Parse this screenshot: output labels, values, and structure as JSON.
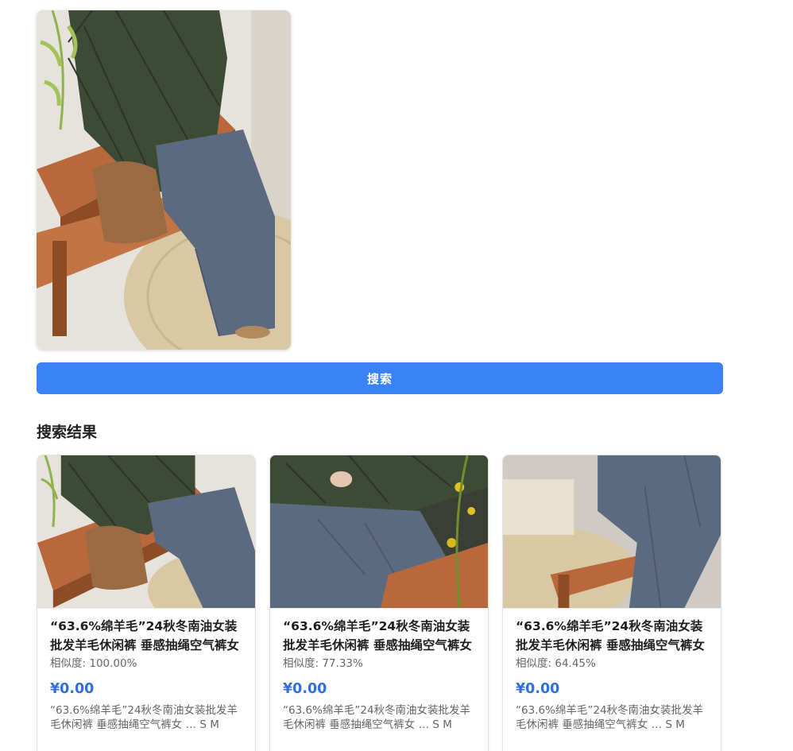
{
  "query": {
    "image_alt": "上传的查询图片：绿色菱格棉服搭配灰蓝色羊毛阔腿裤，坐在木质长椅上"
  },
  "search_button": {
    "label": "搜索"
  },
  "results": {
    "title": "搜索结果",
    "items": [
      {
        "title": "“63.6%绵羊毛”24秋冬南油女装批发羊毛休闲裤 垂感抽绳空气裤女",
        "similarity_label": "相似度:",
        "similarity": "100.00%",
        "price": "¥0.00",
        "description": "“63.6%绵羊毛”24秋冬南油女装批发羊毛休闲裤 垂感抽绳空气裤女 … S M"
      },
      {
        "title": "“63.6%绵羊毛”24秋冬南油女装批发羊毛休闲裤 垂感抽绳空气裤女",
        "similarity_label": "相似度:",
        "similarity": "77.33%",
        "price": "¥0.00",
        "description": "“63.6%绵羊毛”24秋冬南油女装批发羊毛休闲裤 垂感抽绳空气裤女 … S M"
      },
      {
        "title": "“63.6%绵羊毛”24秋冬南油女装批发羊毛休闲裤 垂感抽绳空气裤女",
        "similarity_label": "相似度:",
        "similarity": "64.45%",
        "price": "¥0.00",
        "description": "“63.6%绵羊毛”24秋冬南油女装批发羊毛休闲裤 垂感抽绳空气裤女 … S M"
      }
    ]
  },
  "colors": {
    "accent": "#3b82f6",
    "price": "#2f6fe0",
    "jacket": "#3d4a36",
    "pants": "#5c6a80",
    "wood": "#b8683a",
    "wall": "#e6e2dc",
    "rug": "#d8c8a4",
    "leaf": "#8fb24a"
  }
}
